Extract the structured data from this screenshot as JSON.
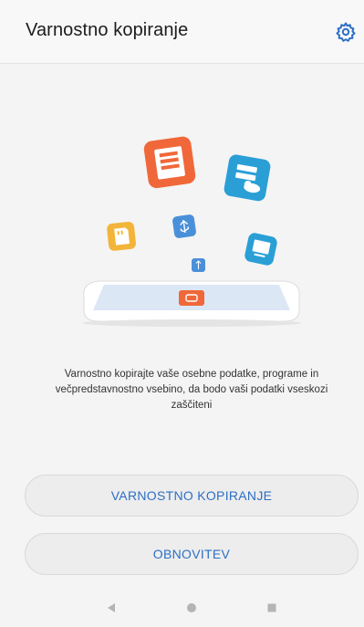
{
  "header": {
    "title": "Varnostno kopiranje",
    "settings_icon": "gear-icon"
  },
  "illustration": {
    "icons": [
      "document-list-icon",
      "cloud-server-icon",
      "sd-card-icon",
      "usb-icon",
      "monitor-icon",
      "usb-small-icon",
      "device-icon"
    ],
    "colors": {
      "orange": "#f0683a",
      "teal": "#2a9fd6",
      "yellow": "#f2b53a",
      "blue": "#4a90d9",
      "screen": "#dbe7f5"
    }
  },
  "description": "Varnostno kopirajte vaše osebne podatke, programe in večpredstavnostno vsebino, da bodo vaši podatki vseskozi zaščiteni",
  "buttons": {
    "backup": "VARNOSTNO KOPIRANJE",
    "restore": "OBNOVITEV"
  },
  "nav": {
    "back_icon": "back-triangle-icon",
    "home_icon": "home-circle-icon",
    "recent_icon": "recent-square-icon"
  },
  "colors": {
    "accent": "#2d6fc4",
    "background": "#f4f4f4"
  }
}
